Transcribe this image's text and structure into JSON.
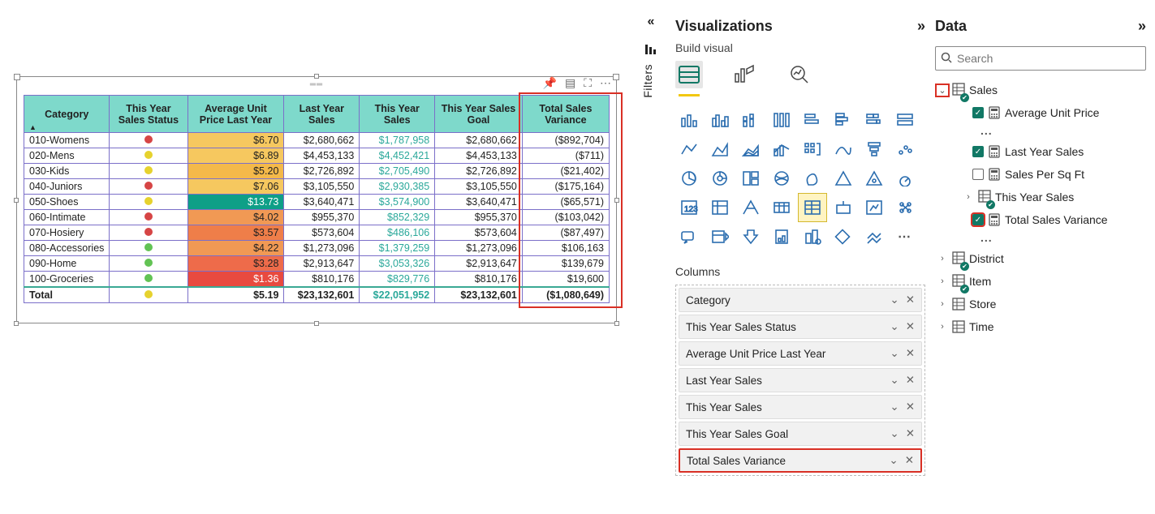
{
  "panes": {
    "viz_title": "Visualizations",
    "build_label": "Build visual",
    "columns_label": "Columns",
    "data_title": "Data",
    "search_placeholder": "Search",
    "filters_label": "Filters"
  },
  "table": {
    "headers": [
      "Category",
      "This Year Sales Status",
      "Average Unit Price Last Year",
      "Last Year Sales",
      "This Year Sales",
      "This Year Sales Goal",
      "Total Sales Variance"
    ],
    "rows": [
      {
        "cat": "010-Womens",
        "status": "r",
        "avg": "$6.70",
        "avg_cls": "bg-yel-l",
        "ly": "$2,680,662",
        "ty": "$1,787,958",
        "goal": "$2,680,662",
        "var": "($892,704)"
      },
      {
        "cat": "020-Mens",
        "status": "y",
        "avg": "$6.89",
        "avg_cls": "bg-yel-l",
        "ly": "$4,453,133",
        "ty": "$4,452,421",
        "goal": "$4,453,133",
        "var": "($711)"
      },
      {
        "cat": "030-Kids",
        "status": "y",
        "avg": "$5.20",
        "avg_cls": "bg-yel-m",
        "ly": "$2,726,892",
        "ty": "$2,705,490",
        "goal": "$2,726,892",
        "var": "($21,402)"
      },
      {
        "cat": "040-Juniors",
        "status": "r",
        "avg": "$7.06",
        "avg_cls": "bg-yel-l",
        "ly": "$3,105,550",
        "ty": "$2,930,385",
        "goal": "$3,105,550",
        "var": "($175,164)"
      },
      {
        "cat": "050-Shoes",
        "status": "y",
        "avg": "$13.73",
        "avg_cls": "bg-teal-d",
        "ly": "$3,640,471",
        "ty": "$3,574,900",
        "goal": "$3,640,471",
        "var": "($65,571)"
      },
      {
        "cat": "060-Intimate",
        "status": "r",
        "avg": "$4.02",
        "avg_cls": "bg-or-l",
        "ly": "$955,370",
        "ty": "$852,329",
        "goal": "$955,370",
        "var": "($103,042)"
      },
      {
        "cat": "070-Hosiery",
        "status": "r",
        "avg": "$3.57",
        "avg_cls": "bg-or-m",
        "ly": "$573,604",
        "ty": "$486,106",
        "goal": "$573,604",
        "var": "($87,497)"
      },
      {
        "cat": "080-Accessories",
        "status": "g",
        "avg": "$4.22",
        "avg_cls": "bg-or-l",
        "ly": "$1,273,096",
        "ty": "$1,379,259",
        "goal": "$1,273,096",
        "var": "$106,163"
      },
      {
        "cat": "090-Home",
        "status": "g",
        "avg": "$3.28",
        "avg_cls": "bg-or-d",
        "ly": "$2,913,647",
        "ty": "$3,053,326",
        "goal": "$2,913,647",
        "var": "$139,679"
      },
      {
        "cat": "100-Groceries",
        "status": "g",
        "avg": "$1.36",
        "avg_cls": "bg-red",
        "ly": "$810,176",
        "ty": "$829,776",
        "goal": "$810,176",
        "var": "$19,600"
      }
    ],
    "total": {
      "label": "Total",
      "status": "y",
      "avg": "$5.19",
      "ly": "$23,132,601",
      "ty": "$22,051,952",
      "goal": "$23,132,601",
      "var": "($1,080,649)"
    }
  },
  "columns": [
    "Category",
    "This Year Sales Status",
    "Average Unit Price Last Year",
    "Last Year Sales",
    "This Year Sales",
    "This Year Sales Goal",
    "Total Sales Variance"
  ],
  "data_tree": {
    "sales": {
      "label": "Sales",
      "fields": [
        {
          "label": "Average Unit Price",
          "checked": true,
          "calc": true
        },
        {
          "label": "Last Year Sales",
          "checked": true,
          "calc": true
        },
        {
          "label": "Sales Per Sq Ft",
          "checked": false,
          "calc": true
        },
        {
          "label": "This Year Sales",
          "checked": null,
          "expandable": true
        },
        {
          "label": "Total Sales Variance",
          "checked": true,
          "calc": true,
          "highlight": true
        }
      ]
    },
    "others": [
      "District",
      "Item",
      "Store",
      "Time"
    ]
  }
}
